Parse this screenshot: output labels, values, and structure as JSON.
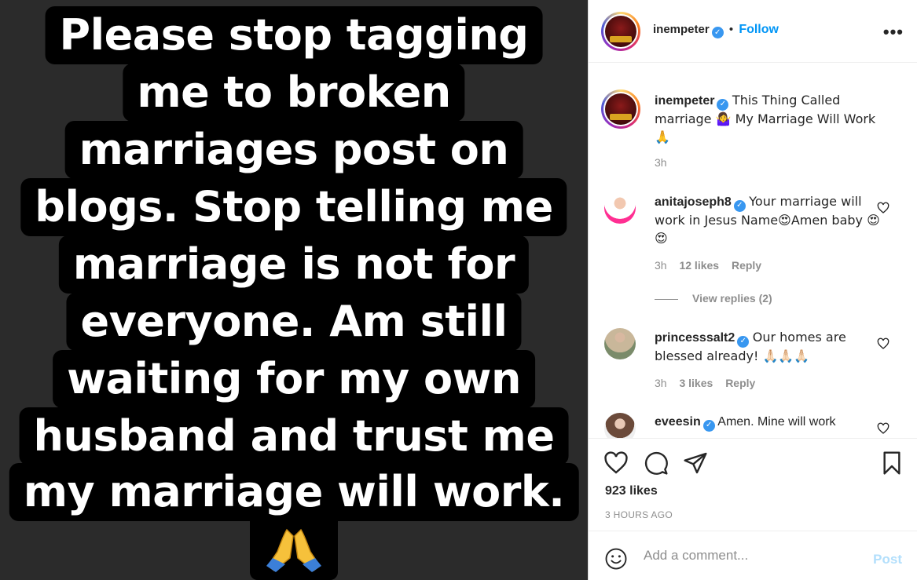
{
  "story": {
    "lines": [
      "Please stop tagging",
      "me to broken",
      "marriages post on",
      "blogs. Stop telling me",
      "marriage is not for",
      "everyone. Am still",
      "waiting for my own",
      "husband and trust me",
      "my marriage will work."
    ],
    "emoji_icon": "folded-hands-icon"
  },
  "header": {
    "username": "inempeter",
    "separator": "•",
    "follow_label": "Follow",
    "more_label": "•••"
  },
  "caption": {
    "username": "inempeter",
    "text": "This Thing Called marriage 🤷‍♀️ My Marriage Will Work 🙏",
    "time": "3h"
  },
  "comments": [
    {
      "username": "anitajoseph8",
      "text": "Your marriage will work in Jesus Name😍Amen baby 😍😍",
      "time": "3h",
      "likes": "12 likes",
      "reply": "Reply",
      "view_replies": "View replies (2)"
    },
    {
      "username": "princesssalt2",
      "text": "Our homes are blessed already! 🙏🏻🙏🏻🙏🏻",
      "time": "3h",
      "likes": "3 likes",
      "reply": "Reply"
    },
    {
      "username": "eveesin",
      "text": "Amen. Mine will work"
    }
  ],
  "actions": {
    "likes": "923 likes",
    "timestamp": "3 HOURS AGO"
  },
  "add_comment": {
    "placeholder": "Add a comment...",
    "post_label": "Post"
  },
  "colors": {
    "accent": "#0095f6",
    "verified": "#3897f0",
    "story_bg": "#2b2b2b",
    "muted": "#8e8e8e"
  }
}
